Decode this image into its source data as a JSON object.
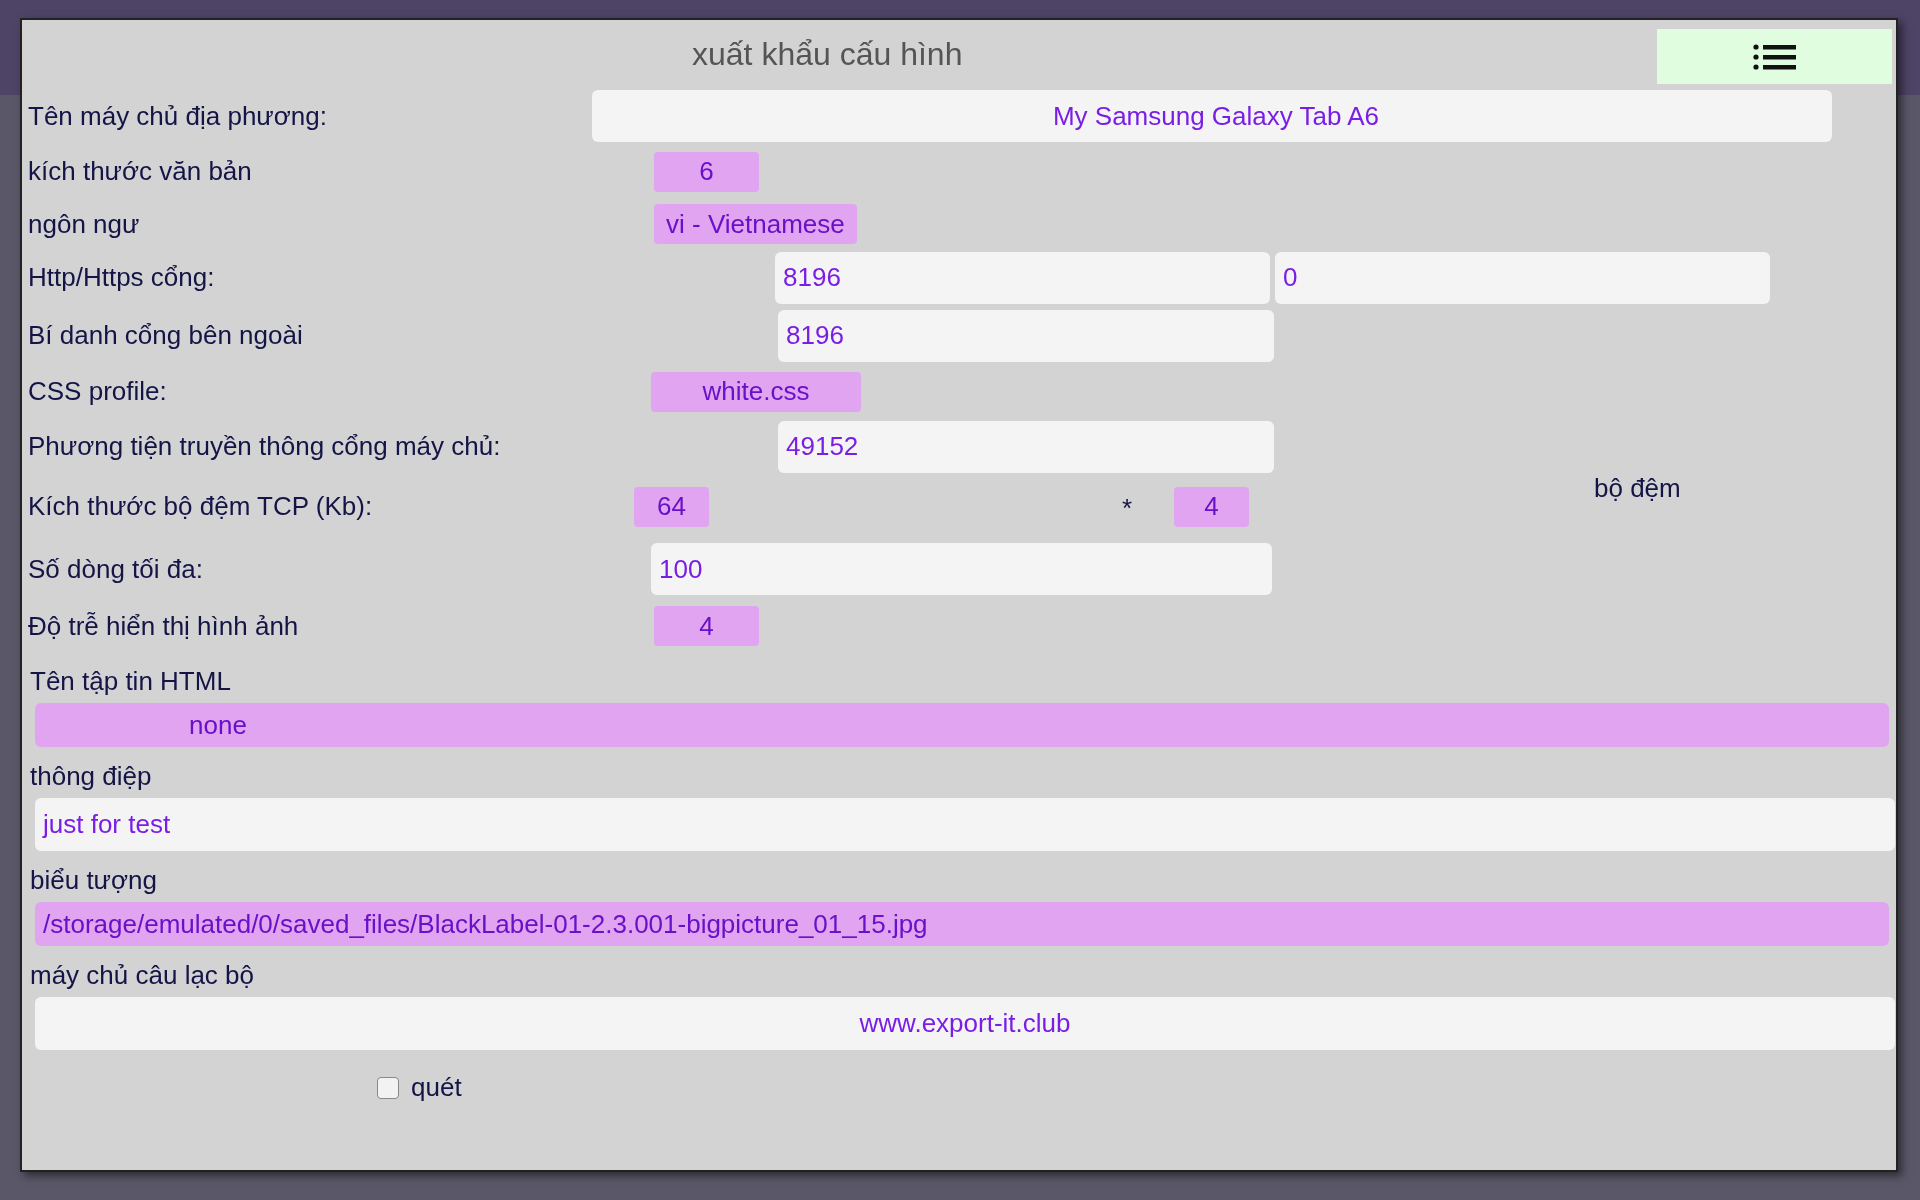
{
  "title": "xuất khẩu cấu hình",
  "rows": [
    {
      "kind": "field-center",
      "label": "Tên máy chủ địa phương:",
      "value": "My Samsung Galaxy Tab A6"
    },
    {
      "kind": "badge",
      "label": "kích thước văn bản",
      "value": "6"
    },
    {
      "kind": "badge",
      "label": "ngôn ngư",
      "value": "vi - Vietnamese"
    },
    {
      "kind": "ports",
      "label": "Http/Https cổng:",
      "values": [
        "8196",
        "0"
      ]
    },
    {
      "kind": "field",
      "label": "Bí danh cổng bên ngoài",
      "value": "8196"
    },
    {
      "kind": "badge",
      "label": "CSS profile:",
      "value": "white.css"
    },
    {
      "kind": "field",
      "label": "Phương tiện truyền thông cổng máy chủ:",
      "value": "49152"
    },
    {
      "kind": "tcp",
      "label": "Kích thước bộ đệm TCP (Kb):",
      "values": [
        "64",
        "4"
      ],
      "separator": "*",
      "unit": "bộ đệm"
    },
    {
      "kind": "field",
      "label": "Số dòng tối đa:",
      "value": "100"
    },
    {
      "kind": "badge",
      "label": "Độ trễ hiển thị hình ảnh",
      "value": "4"
    }
  ],
  "blocks": [
    {
      "kind": "select",
      "label": "Tên tập tin HTML",
      "value": "none"
    },
    {
      "kind": "field",
      "label": "thông điệp",
      "value": "just for test"
    },
    {
      "kind": "select-left",
      "label": "biểu tượng",
      "value": "/storage/emulated/0/saved_files/BlackLabel-01-2.3.001-bigpicture_01_15.jpg"
    },
    {
      "kind": "field-center",
      "label": "máy chủ câu lạc bộ",
      "value": "www.export-it.club"
    }
  ],
  "checkbox": {
    "label": "quét",
    "checked": false
  }
}
